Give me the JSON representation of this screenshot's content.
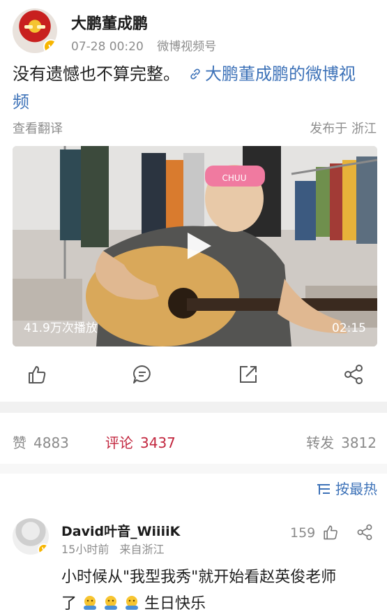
{
  "post": {
    "author": "大鹏董成鹏",
    "time": "07-28 00:20",
    "source": "微博视频号",
    "text": "没有遗憾也不算完整。",
    "link_text_line1": "大鹏董成鹏的微博视",
    "link_text_line2": "频",
    "translate": "查看翻译",
    "location": "发布于 浙江"
  },
  "video": {
    "views": "41.9万次播放",
    "duration": "02:15",
    "headband_text": "CHUU"
  },
  "stats": {
    "like_label": "赞",
    "like_count": "4883",
    "comment_label": "评论",
    "comment_count": "3437",
    "repost_label": "转发",
    "repost_count": "3812"
  },
  "sort": {
    "label": "按最热"
  },
  "comment": {
    "author": "David叶音_WiiiiK",
    "time": "15小时前",
    "source": "来自浙江",
    "likes": "159",
    "text_line1": "小时候从\"我型我秀\"就开始看赵英俊老师",
    "text_line2_prefix": "了",
    "text_line2_suffix": "生日快乐"
  },
  "colors": {
    "link": "#3d72b8",
    "comment_active": "#c2263e",
    "muted": "#8d8d8d",
    "verified_badge": "#f7b500"
  },
  "icons": [
    "verified-badge-icon",
    "link-icon",
    "play-icon",
    "like-icon",
    "comment-icon",
    "repost-icon",
    "share-icon",
    "sort-icon",
    "emoji-hug-icon"
  ]
}
